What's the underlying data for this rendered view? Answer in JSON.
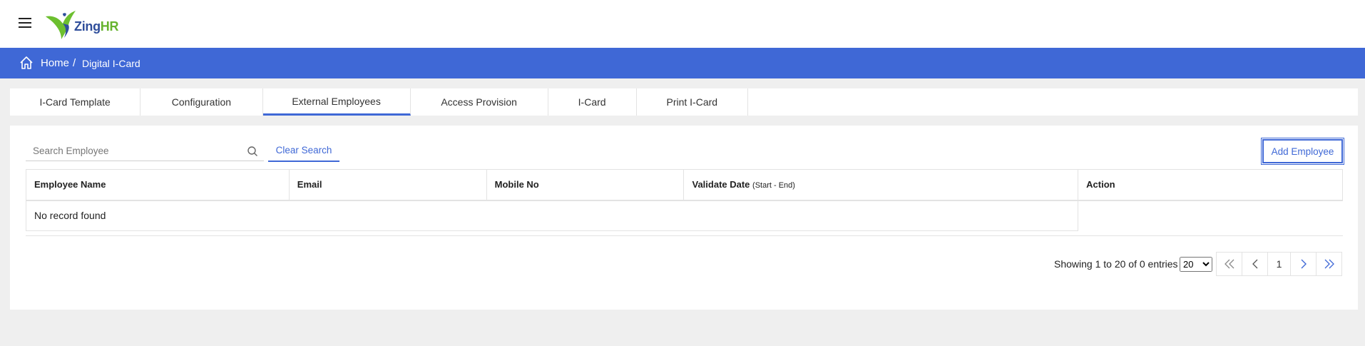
{
  "header": {
    "logo_text_zing": "Zing",
    "logo_text_hr": "HR"
  },
  "breadcrumb": {
    "home": "Home",
    "separator": "/",
    "current": "Digital I-Card"
  },
  "tabs": [
    {
      "label": "I-Card Template",
      "active": false
    },
    {
      "label": "Configuration",
      "active": false
    },
    {
      "label": "External Employees",
      "active": true
    },
    {
      "label": "Access Provision",
      "active": false
    },
    {
      "label": "I-Card",
      "active": false
    },
    {
      "label": "Print I-Card",
      "active": false
    }
  ],
  "toolbar": {
    "search_placeholder": "Search Employee",
    "clear_label": "Clear Search",
    "add_label": "Add Employee"
  },
  "table": {
    "columns": [
      "Employee Name",
      "Email",
      "Mobile No",
      "Validate Date",
      "Action"
    ],
    "date_hint_open": "(",
    "date_hint": "Start - End",
    "date_hint_close": ")",
    "empty_message": "No record found"
  },
  "pagination": {
    "info": "Showing 1 to 20 of 0 entries",
    "page_size": "20",
    "current_page": "1"
  },
  "colors": {
    "accent": "#3f68d6",
    "background": "#efefef"
  }
}
